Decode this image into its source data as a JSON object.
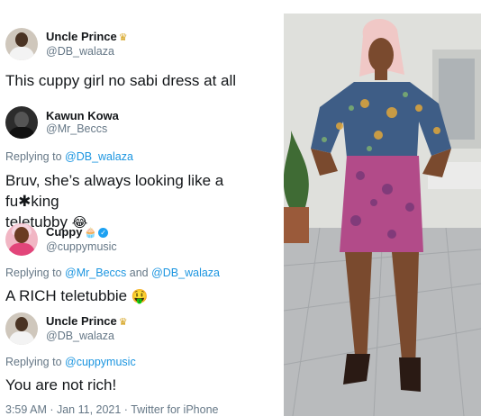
{
  "tweets": [
    {
      "name": "Uncle Prince",
      "name_glyph": "♛",
      "handle": "@DB_walaza",
      "text": "This cuppy girl no sabi dress at all"
    },
    {
      "name": "Kawun Kowa",
      "handle": "@Mr_Beccs",
      "reply_prefix": "Replying to ",
      "reply_to": "@DB_walaza",
      "text_line1": "Bruv, she’s always looking like a fu✱king",
      "text_line2": "teletubby",
      "emoji": "😂"
    },
    {
      "name": "Cuppy",
      "name_glyph": "🧁",
      "verified": "✓",
      "handle": "@cuppymusic",
      "reply_prefix": "Replying to ",
      "reply_to_1": "@Mr_Beccs",
      "reply_and": " and ",
      "reply_to_2": "@DB_walaza",
      "text": "A RICH teletubbie",
      "emoji": "🤑"
    },
    {
      "name": "Uncle Prince",
      "name_glyph": "♛",
      "handle": "@DB_walaza",
      "reply_prefix": "Replying to ",
      "reply_to": "@cuppymusic",
      "text": "You are not rich!"
    }
  ],
  "meta": "3:59 AM · Jan 11, 2021 · Twitter for iPhone",
  "photo": {
    "subject": "woman in printed ankara top and pink patterned pencil skirt with gladiator sandals",
    "colors": {
      "wall": "#dfe0dc",
      "pavement": "#b9bbbd",
      "top": "#3e5d86",
      "skirt": "#b24b89",
      "skin": "#7a4a2e",
      "hair": "#f0c8c6"
    }
  }
}
